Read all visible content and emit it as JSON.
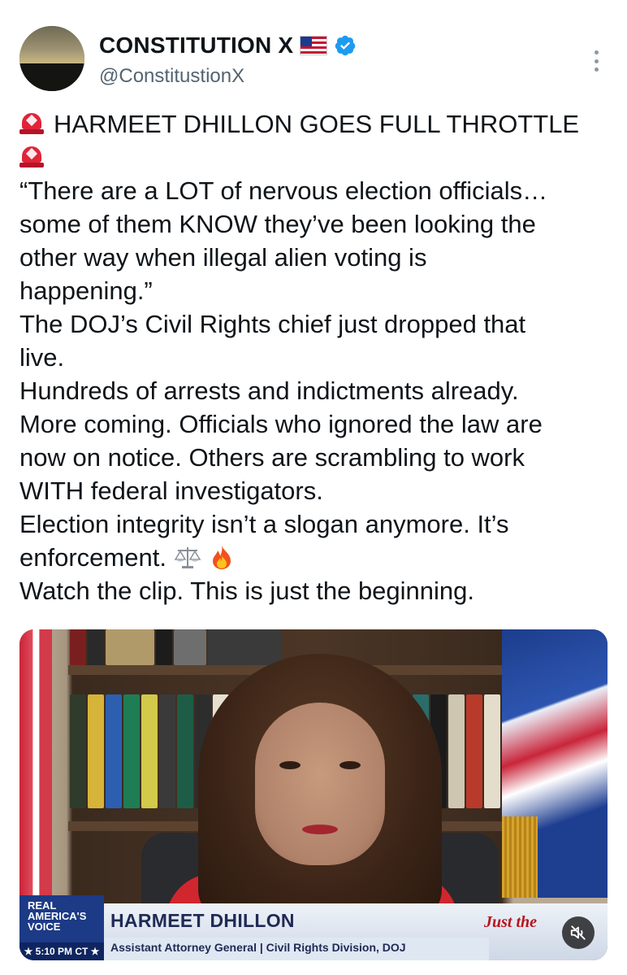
{
  "tweet": {
    "author": {
      "display_name": "CONSTITUTION X",
      "handle": "@ConstitustionX",
      "flag_icon": "us-flag-icon",
      "verified_icon": "verified-badge-icon"
    },
    "body_lines": [
      "HARMEET DHILLON GOES FULL THROTTLE",
      "",
      "“There are a LOT of nervous election officials…",
      "some of them KNOW they’ve been looking the",
      "other way when illegal alien voting is",
      "happening.”",
      "The DOJ’s Civil Rights chief just dropped that",
      "live.",
      "Hundreds of arrests and indictments already.",
      "More coming. Officials who ignored the law are",
      "now on notice. Others are scrambling to work",
      "WITH federal investigators.",
      "Election integrity isn’t a slogan anymore. It’s",
      "enforcement.",
      "Watch the clip. This is just the beginning."
    ],
    "emoji": {
      "siren": "police-car-light-icon",
      "scales": "balance-scale-icon",
      "fire": "fire-icon"
    }
  },
  "video": {
    "lower_third_name": "HARMEET DHILLON",
    "lower_third_title": "Assistant Attorney General | Civil Rights Division, DOJ",
    "network_logo_line1": "REAL",
    "network_logo_line2": "AMERICA'S",
    "network_logo_line3": "VOICE",
    "time_label": "★ 5:10 PM CT ★",
    "corner_logo": "Just the",
    "mute_icon": "mute-icon"
  },
  "colors": {
    "text": "#0f1419",
    "secondary": "#536471",
    "verified": "#1d9bf0"
  }
}
